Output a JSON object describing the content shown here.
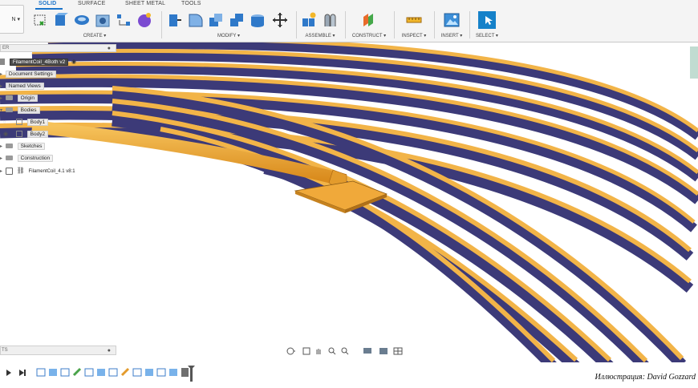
{
  "toolbar": {
    "workspace_label": "N ▾",
    "tabs": [
      {
        "label": "SOLID",
        "active": true
      },
      {
        "label": "SURFACE",
        "active": false
      },
      {
        "label": "SHEET METAL",
        "active": false
      },
      {
        "label": "TOOLS",
        "active": false
      }
    ],
    "groups": [
      {
        "label": "CREATE ▾"
      },
      {
        "label": "MODIFY ▾"
      },
      {
        "label": "ASSEMBLE ▾"
      },
      {
        "label": "CONSTRUCT ▾"
      },
      {
        "label": "INSPECT ▾"
      },
      {
        "label": "INSERT ▾"
      },
      {
        "label": "SELECT ▾"
      }
    ]
  },
  "browser": {
    "header": "ER",
    "document": "FilamentCoil_4Both v2",
    "items": [
      {
        "label": "Document Settings"
      },
      {
        "label": "Named Views"
      },
      {
        "label": "Origin"
      },
      {
        "label": "Bodies"
      },
      {
        "label": "Body1"
      },
      {
        "label": "Body2"
      },
      {
        "label": "Sketches"
      },
      {
        "label": "Construction"
      },
      {
        "label": "FilamentCoil_4.1 v8:1"
      }
    ]
  },
  "comments": {
    "label": "TS"
  },
  "credit": "Иллюстрация: David Gozzard",
  "colors": {
    "accent": "#1a73c9",
    "filament_gold": "#f0a93a",
    "filament_blue": "#3c3a78"
  }
}
